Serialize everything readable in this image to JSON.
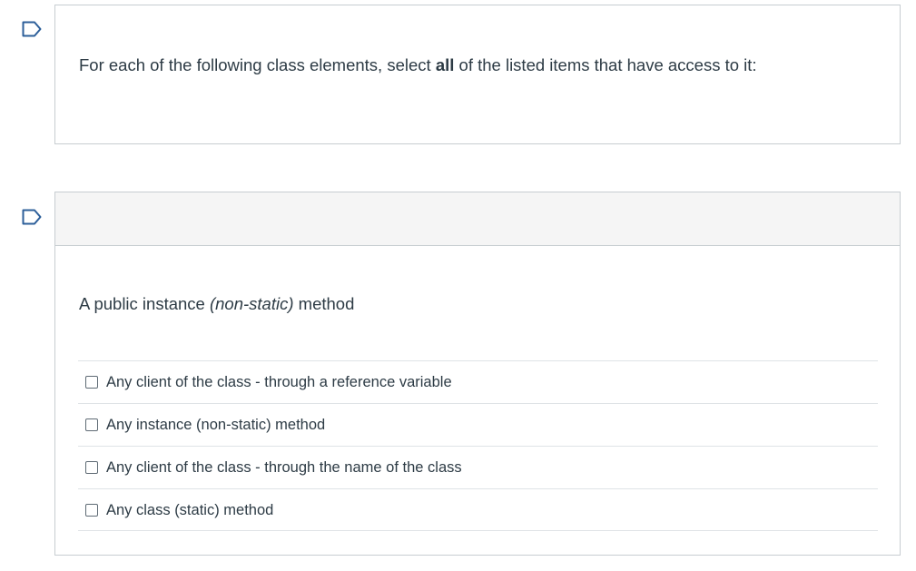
{
  "intro": {
    "text_before": "For each of the following class elements, select ",
    "text_bold": "all",
    "text_after": " of the listed items that have access to it:"
  },
  "question": {
    "prompt_before": "A public instance ",
    "prompt_italic": "(non-static)",
    "prompt_after": " method",
    "answers": [
      {
        "label": "Any client of the class - through a reference variable",
        "checked": false
      },
      {
        "label": "Any instance (non-static) method",
        "checked": false
      },
      {
        "label": "Any client of the class - through the name of the class",
        "checked": false
      },
      {
        "label": "Any class (static) method",
        "checked": false
      }
    ]
  },
  "icons": {
    "flag": "bookmark-flag-icon"
  },
  "colors": {
    "accent": "#2d5f9a",
    "text": "#2d3b45",
    "border": "#c7cdd1",
    "header_bg": "#f5f5f5"
  }
}
